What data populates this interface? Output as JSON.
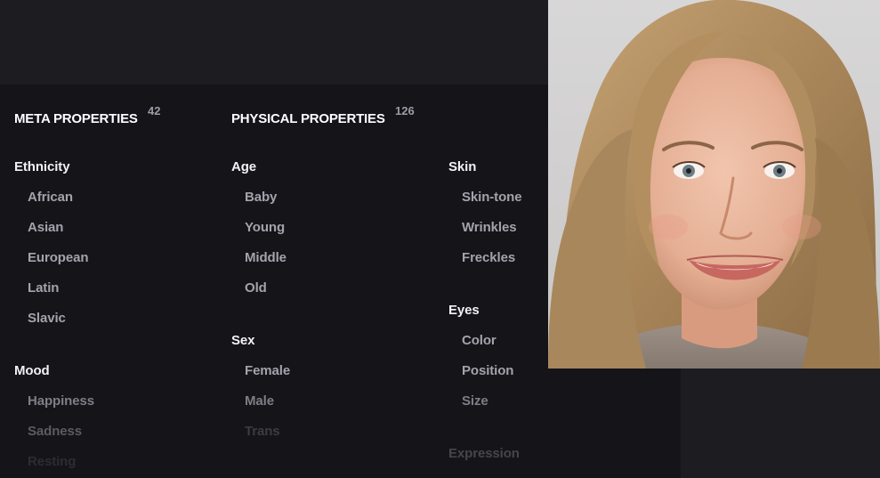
{
  "meta": {
    "title": "META PROPERTIES",
    "count": "42",
    "groups": [
      {
        "label": "Ethnicity",
        "items": [
          "African",
          "Asian",
          "European",
          "Latin",
          "Slavic"
        ]
      },
      {
        "label": "Mood",
        "items": [
          "Happiness",
          "Sadness",
          "Resting"
        ]
      }
    ]
  },
  "physical": {
    "title": "PHYSICAL PROPERTIES",
    "count": "126",
    "groups": [
      {
        "label": "Age",
        "items": [
          "Baby",
          "Young",
          "Middle",
          "Old"
        ]
      },
      {
        "label": "Sex",
        "items": [
          "Female",
          "Male",
          "Trans"
        ]
      },
      {
        "label": "Skin",
        "items": [
          "Skin-tone",
          "Wrinkles",
          "Freckles"
        ]
      },
      {
        "label": "Eyes",
        "items": [
          "Color",
          "Position",
          "Size"
        ]
      },
      {
        "label": "Expression",
        "items": []
      }
    ]
  },
  "photo": {
    "subject": "smiling woman with shoulder-length blonde hair"
  },
  "colors": {
    "panel_bg": "#141419",
    "page_bg": "#1b1b1f",
    "heading": "#ffffff",
    "item": "#a3a3ac"
  }
}
